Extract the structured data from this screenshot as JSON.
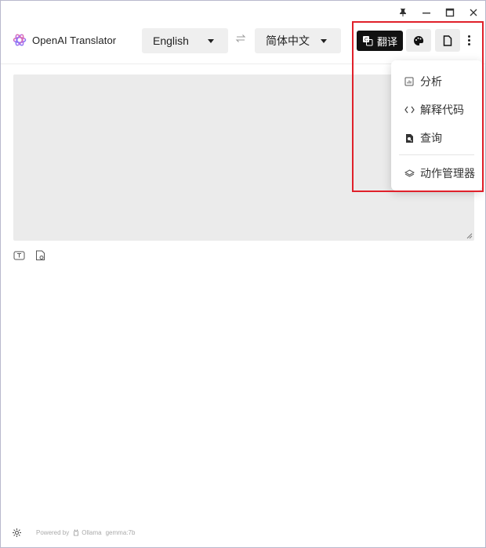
{
  "app": {
    "title": "OpenAI Translator"
  },
  "languages": {
    "source": "English",
    "target": "简体中文"
  },
  "toolbar": {
    "translate_label": "翻译"
  },
  "menu": {
    "items": [
      {
        "label": "分析",
        "icon": "chart-icon"
      },
      {
        "label": "解释代码",
        "icon": "code-icon"
      },
      {
        "label": "查询",
        "icon": "file-search-icon"
      },
      {
        "label": "动作管理器",
        "icon": "layers-icon"
      }
    ]
  },
  "editor": {
    "value": ""
  },
  "footer": {
    "powered_by": "Powered by",
    "provider": "Ollama",
    "model": "gemma:7b"
  },
  "colors": {
    "highlight": "#e0202a",
    "primary_button": "#111111",
    "input_bg": "#ebebeb"
  }
}
